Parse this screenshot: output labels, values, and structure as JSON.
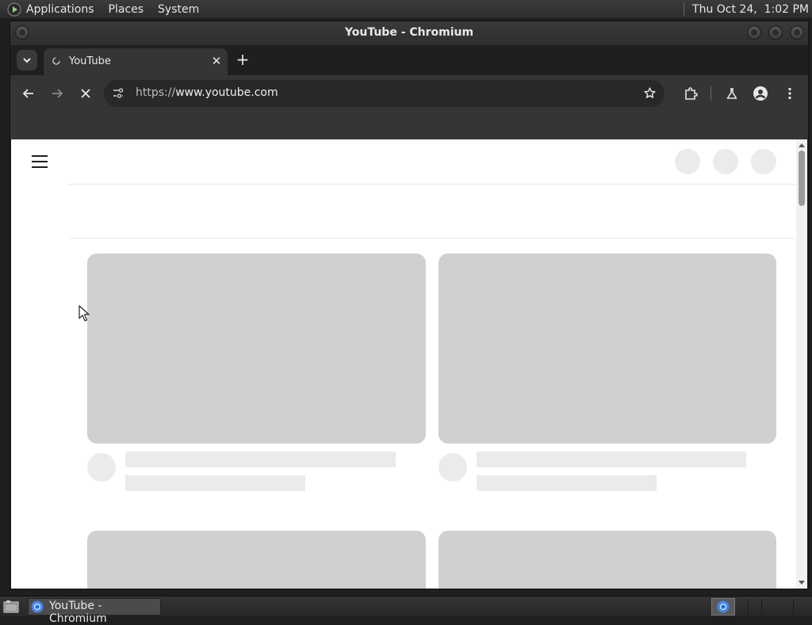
{
  "top_panel": {
    "menus": [
      "Applications",
      "Places",
      "System"
    ],
    "clock": "Thu Oct 24,  1:02 PM"
  },
  "window": {
    "title": "YouTube - Chromium"
  },
  "tabs": [
    {
      "label": "YouTube",
      "icon": "loading-favicon-icon"
    }
  ],
  "toolbar": {
    "url_scheme": "https://",
    "url_domain": "www.youtube.com",
    "back": "arrow-left-icon",
    "forward": "arrow-right-icon",
    "stop": "close-icon",
    "extensions": "puzzle-icon",
    "labs": "flask-icon",
    "profile": "person-icon",
    "menu": "more-vert-icon"
  },
  "taskbar": {
    "items": [
      {
        "label": "YouTube - Chromium",
        "icon": "chromium-icon"
      }
    ]
  },
  "colors": {
    "skeleton_thumb": "#d0d0d0",
    "skeleton_line": "#ebebeb",
    "chrome_dark": "#202124",
    "toolbar": "#353535"
  }
}
